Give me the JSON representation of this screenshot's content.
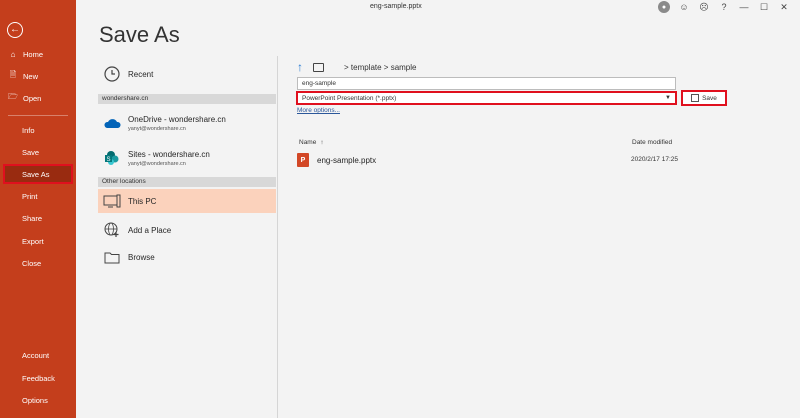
{
  "window": {
    "doc_title": "eng-sample.pptx",
    "avatar_initial": "",
    "window_buttons": [
      "?",
      "—",
      "☐",
      "✕"
    ]
  },
  "sidebar": {
    "back_icon": "back-arrow-icon",
    "items": [
      {
        "label": "Home",
        "icon": "home-icon"
      },
      {
        "label": "New",
        "icon": "new-doc-icon"
      },
      {
        "label": "Open",
        "icon": "folder-open-icon"
      },
      {
        "label": "Info"
      },
      {
        "label": "Save"
      },
      {
        "label": "Save As",
        "active": true
      },
      {
        "label": "Print"
      },
      {
        "label": "Share"
      },
      {
        "label": "Export"
      },
      {
        "label": "Close"
      },
      {
        "label": "Account"
      },
      {
        "label": "Feedback"
      },
      {
        "label": "Options"
      }
    ],
    "bg_color": "#c43e1c",
    "active_color": "#992b10"
  },
  "page": {
    "title": "Save As"
  },
  "locations": {
    "recent": "Recent",
    "section_wondershare": "wondershare.cn",
    "onedrive": {
      "label": "OneDrive - wondershare.cn",
      "sub": "yanyt@wondershare.cn"
    },
    "sites": {
      "label": "Sites - wondershare.cn",
      "sub": "yanyt@wondershare.cn"
    },
    "section_other": "Other locations",
    "this_pc": "This PC",
    "add_place": "Add a Place",
    "browse": "Browse"
  },
  "save_panel": {
    "path": "> template > sample",
    "filename": "eng-sample",
    "filetype": "PowerPoint Presentation (*.pptx)",
    "more_options": "More options...",
    "save_label": "Save",
    "highlight_color": "#e0101e"
  },
  "file_list": {
    "col_name": "Name",
    "col_sort": "↑",
    "col_date": "Date modified",
    "rows": [
      {
        "name": "eng-sample.pptx",
        "date": "2020/2/17 17:25",
        "icon_letter": "P"
      }
    ]
  }
}
